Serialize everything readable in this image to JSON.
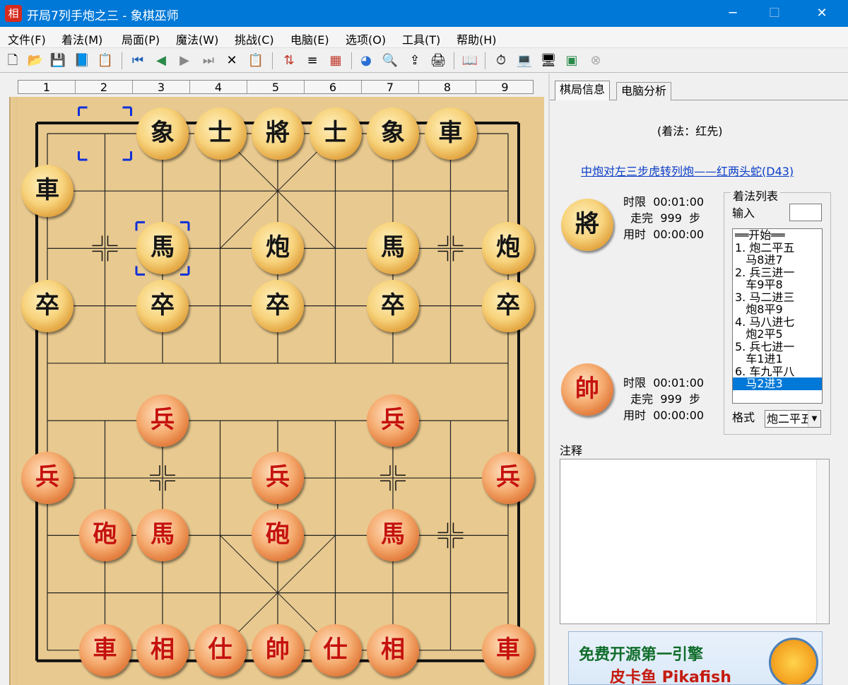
{
  "window": {
    "app_icon_char": "相",
    "title": "开局7列手炮之三 - 象棋巫师"
  },
  "menu": [
    "文件(F)",
    "着法(M)",
    "局面(P)",
    "魔法(W)",
    "挑战(C)",
    "电脑(E)",
    "选项(O)",
    "工具(T)",
    "帮助(H)"
  ],
  "toolbar_icons": [
    "new-file-icon",
    "open-folder-icon",
    "save-icon",
    "book-icon",
    "properties-icon",
    "first-move-icon",
    "prev-move-icon",
    "next-move-icon",
    "last-move-icon",
    "delete-icon",
    "paste-icon",
    "flip-board-icon",
    "move-tree-icon",
    "calculator-icon",
    "color-wheel-icon",
    "search-icon",
    "export-icon",
    "print-icon",
    "opening-book-icon",
    "clock-icon",
    "laptop-icon",
    "computer-icon",
    "monitor-icon",
    "stop-icon"
  ],
  "ruler": [
    "1",
    "2",
    "3",
    "4",
    "5",
    "6",
    "7",
    "8",
    "9"
  ],
  "pieces": [
    {
      "side": "black",
      "ch": "象",
      "col": 3,
      "row": 0
    },
    {
      "side": "black",
      "ch": "士",
      "col": 4,
      "row": 0
    },
    {
      "side": "black",
      "ch": "將",
      "col": 5,
      "row": 0
    },
    {
      "side": "black",
      "ch": "士",
      "col": 6,
      "row": 0
    },
    {
      "side": "black",
      "ch": "象",
      "col": 7,
      "row": 0
    },
    {
      "side": "black",
      "ch": "車",
      "col": 8,
      "row": 0
    },
    {
      "side": "black",
      "ch": "車",
      "col": 1,
      "row": 1
    },
    {
      "side": "black",
      "ch": "馬",
      "col": 3,
      "row": 2
    },
    {
      "side": "black",
      "ch": "炮",
      "col": 5,
      "row": 2
    },
    {
      "side": "black",
      "ch": "馬",
      "col": 7,
      "row": 2
    },
    {
      "side": "black",
      "ch": "炮",
      "col": 9,
      "row": 2
    },
    {
      "side": "black",
      "ch": "卒",
      "col": 1,
      "row": 3
    },
    {
      "side": "black",
      "ch": "卒",
      "col": 3,
      "row": 3
    },
    {
      "side": "black",
      "ch": "卒",
      "col": 5,
      "row": 3
    },
    {
      "side": "black",
      "ch": "卒",
      "col": 7,
      "row": 3
    },
    {
      "side": "black",
      "ch": "卒",
      "col": 9,
      "row": 3
    },
    {
      "side": "red",
      "ch": "兵",
      "col": 3,
      "row": 5
    },
    {
      "side": "red",
      "ch": "兵",
      "col": 7,
      "row": 5
    },
    {
      "side": "red",
      "ch": "兵",
      "col": 1,
      "row": 6
    },
    {
      "side": "red",
      "ch": "兵",
      "col": 5,
      "row": 6
    },
    {
      "side": "red",
      "ch": "兵",
      "col": 9,
      "row": 6
    },
    {
      "side": "red",
      "ch": "砲",
      "col": 2,
      "row": 7
    },
    {
      "side": "red",
      "ch": "馬",
      "col": 3,
      "row": 7
    },
    {
      "side": "red",
      "ch": "砲",
      "col": 5,
      "row": 7
    },
    {
      "side": "red",
      "ch": "馬",
      "col": 7,
      "row": 7
    },
    {
      "side": "red",
      "ch": "車",
      "col": 2,
      "row": 9
    },
    {
      "side": "red",
      "ch": "相",
      "col": 3,
      "row": 9
    },
    {
      "side": "red",
      "ch": "仕",
      "col": 4,
      "row": 9
    },
    {
      "side": "red",
      "ch": "帥",
      "col": 5,
      "row": 9
    },
    {
      "side": "red",
      "ch": "仕",
      "col": 6,
      "row": 9
    },
    {
      "side": "red",
      "ch": "相",
      "col": 7,
      "row": 9
    },
    {
      "side": "red",
      "ch": "車",
      "col": 9,
      "row": 9
    }
  ],
  "last_move": {
    "from": {
      "col": 2,
      "row": 0
    },
    "to": {
      "col": 3,
      "row": 2
    }
  },
  "panel": {
    "tabs": [
      "棋局信息",
      "电脑分析"
    ],
    "move_note": "(着法：红先)",
    "opening_link": "中炮对左三步虎转列炮——红两头蛇(D43)",
    "black_player": {
      "piece": "將",
      "time_limit_label": "时限",
      "time_limit": "00:01:00",
      "moves_label": "走完",
      "moves": "999",
      "moves_unit": "步",
      "time_used_label": "用时",
      "time_used": "00:00:00"
    },
    "red_player": {
      "piece": "帥",
      "time_limit_label": "时限",
      "time_limit": "00:01:00",
      "moves_label": "走完",
      "moves": "999",
      "moves_unit": "步",
      "time_used_label": "用时",
      "time_used": "00:00:00"
    },
    "movelist_title": "着法列表",
    "input_label": "输入",
    "moves": [
      "══开始══",
      "1. 炮二平五",
      "   马8进7",
      "2. 兵三进一",
      "   车9平8",
      "3. 马二进三",
      "   炮8平9",
      "4. 马八进七",
      "   炮2平5",
      "5. 兵七进一",
      "   车1进1",
      "6. 车九平八",
      "   马2进3"
    ],
    "selected_move": 12,
    "format_label": "格式",
    "format_value": "炮二平五",
    "notes_label": "注释",
    "banner_line1": "免费开源第一引擎",
    "banner_line2": "皮卡鱼 Pikafish"
  }
}
